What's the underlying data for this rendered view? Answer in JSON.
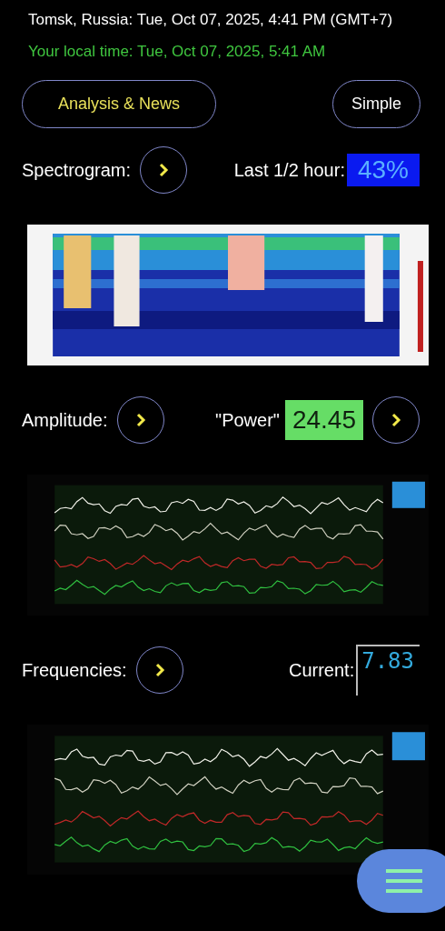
{
  "location_time": "Tomsk, Russia: Tue, Oct 07, 2025, 4:41 PM (GMT+7)",
  "local_time": "Your local time: Tue, Oct 07, 2025, 5:41 AM",
  "buttons": [
    {
      "label": "Analysis & News",
      "kind": "accent"
    },
    {
      "label": "Simple",
      "kind": "plain"
    }
  ],
  "sections": [
    {
      "kind": "spectrogram",
      "label": "Spectrogram:",
      "reading_label": "Last 1/2 hour:",
      "reading": "43%",
      "more_button": false
    },
    {
      "kind": "amplitude",
      "label": "Amplitude:",
      "reading_label": "\"Power\"",
      "reading": "24.45",
      "more_button": true
    },
    {
      "kind": "frequencies",
      "label": "Frequencies:",
      "reading_label": "Current:",
      "reading": "7.83",
      "more_button": false
    }
  ]
}
